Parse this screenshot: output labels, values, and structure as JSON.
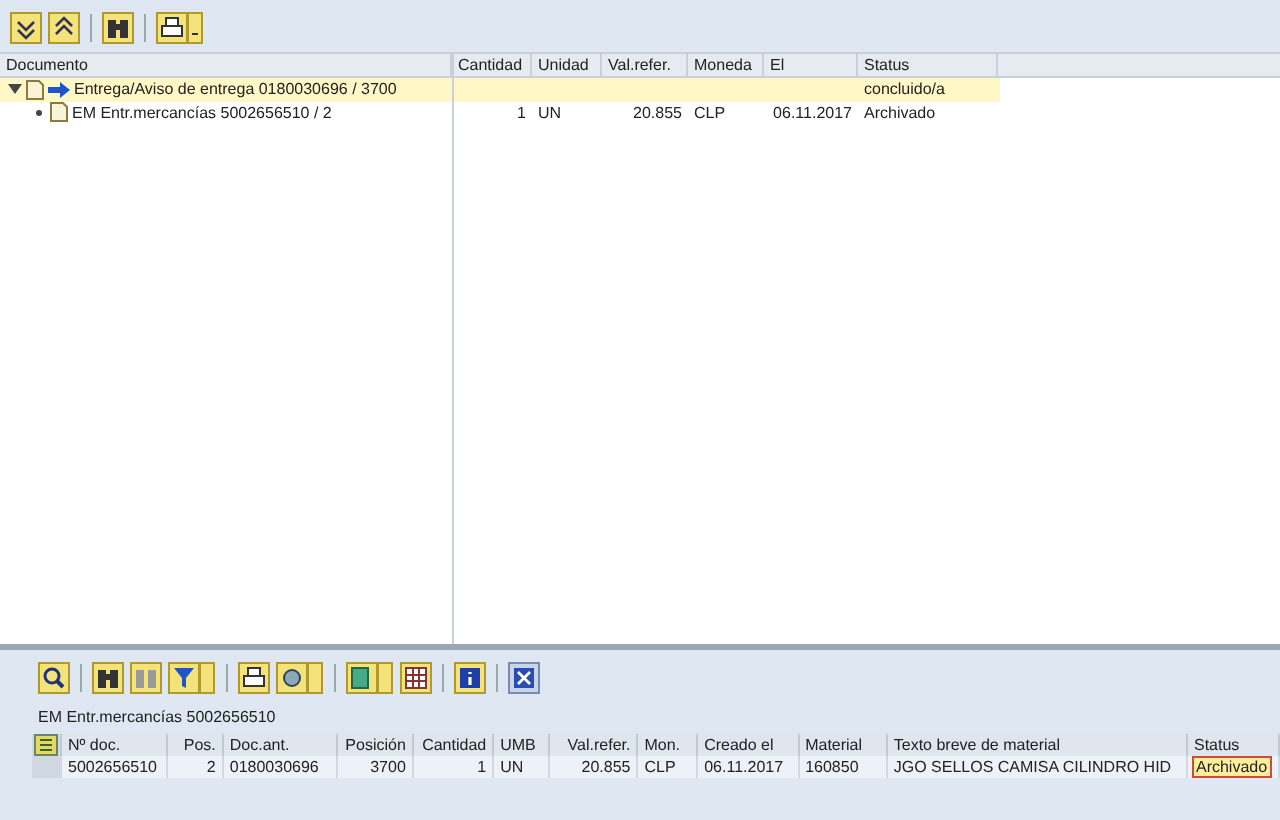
{
  "tree": {
    "columns": [
      "Documento",
      "Cantidad",
      "Unidad",
      "Val.refer.",
      "Moneda",
      "El",
      "Status"
    ],
    "nodes": [
      {
        "label": "Entrega/Aviso de entrega 0180030696 / 3700",
        "expanded": true,
        "selected": true,
        "cells": [
          "",
          "",
          "",
          "",
          "",
          "concluido/a"
        ],
        "children": [
          {
            "label": "EM Entr.mercancías 5002656510 / 2",
            "selected": false,
            "cells": [
              "1",
              "UN",
              "20.855",
              "CLP",
              "06.11.2017",
              "Archivado"
            ]
          }
        ]
      }
    ]
  },
  "detail": {
    "title": "EM Entr.mercancías 5002656510",
    "columns": [
      "Nº doc.",
      "Pos.",
      "Doc.ant.",
      "Posición",
      "Cantidad",
      "UMB",
      "Val.refer.",
      "Mon.",
      "Creado el",
      "Material",
      "Texto breve de material",
      "Status"
    ],
    "rows": [
      {
        "cells": [
          "5002656510",
          "2",
          "0180030696",
          "3700",
          "1",
          "UN",
          "20.855",
          "CLP",
          "06.11.2017",
          "160850",
          "JGO SELLOS CAMISA CILINDRO HID",
          "Archivado"
        ],
        "status_highlighted": true
      }
    ]
  }
}
